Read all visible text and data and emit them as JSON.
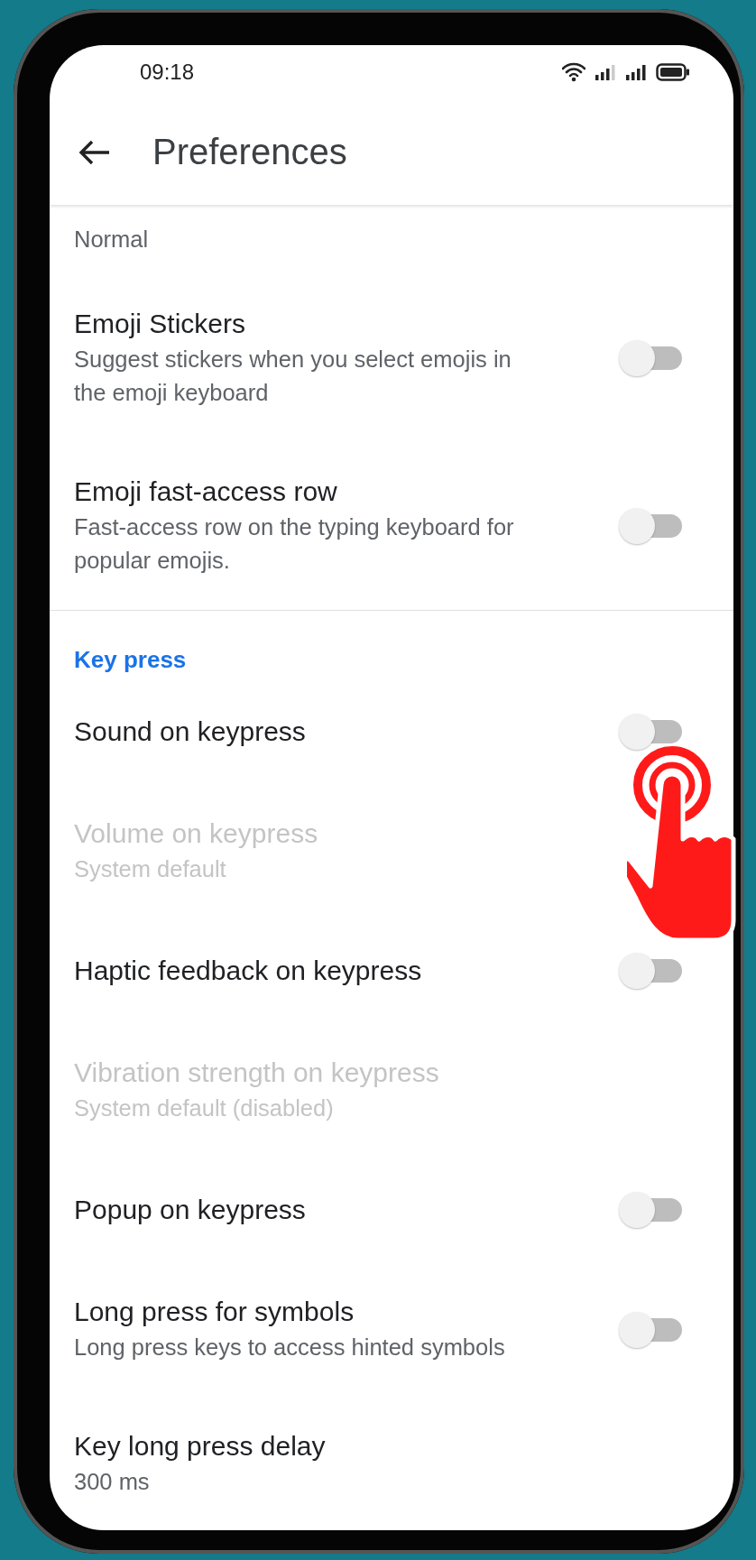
{
  "status_bar": {
    "time": "09:18"
  },
  "header": {
    "title": "Preferences"
  },
  "items": [
    {
      "kind": "setting",
      "subtitle": "Normal",
      "disabled": false
    },
    {
      "kind": "setting",
      "title": "Emoji Stickers",
      "subtitle": "Suggest stickers when you select emojis in the emoji keyboard",
      "disabled": false,
      "toggle": {
        "on": false
      }
    },
    {
      "kind": "setting",
      "title": "Emoji fast-access row",
      "subtitle": "Fast-access row on the typing keyboard for popular emojis.",
      "disabled": false,
      "toggle": {
        "on": false
      }
    },
    {
      "kind": "section",
      "title": "Key press"
    },
    {
      "kind": "setting",
      "title": "Sound on keypress",
      "disabled": false,
      "toggle": {
        "on": false
      }
    },
    {
      "kind": "setting",
      "title": "Volume on keypress",
      "subtitle": "System default",
      "disabled": true
    },
    {
      "kind": "setting",
      "title": "Haptic feedback on keypress",
      "disabled": false,
      "toggle": {
        "on": false
      }
    },
    {
      "kind": "setting",
      "title": "Vibration strength on keypress",
      "subtitle": "System default (disabled)",
      "disabled": true
    },
    {
      "kind": "setting",
      "title": "Popup on keypress",
      "disabled": false,
      "toggle": {
        "on": false
      }
    },
    {
      "kind": "setting",
      "title": "Long press for symbols",
      "subtitle": "Long press keys to access hinted symbols",
      "disabled": false,
      "toggle": {
        "on": false
      }
    },
    {
      "kind": "setting",
      "title": "Key long press delay",
      "subtitle": "300 ms",
      "disabled": false
    }
  ]
}
